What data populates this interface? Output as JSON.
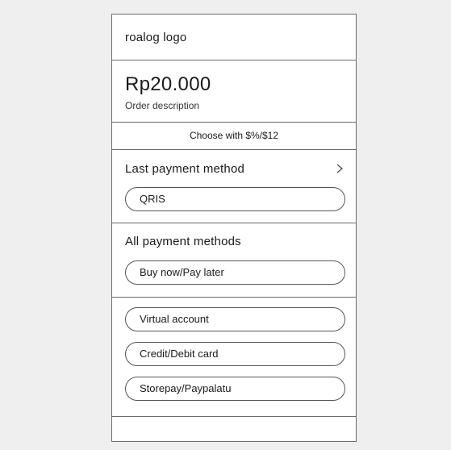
{
  "header": {
    "logo_text": "roalog logo"
  },
  "order": {
    "amount": "Rp20.000",
    "description": "Order description"
  },
  "choose": {
    "label": "Choose with $%/$12"
  },
  "last_payment": {
    "title": "Last payment method",
    "chevron_icon": "chevron-right-icon",
    "items": [
      {
        "label": "QRIS"
      }
    ]
  },
  "all_payment": {
    "title": "All payment methods",
    "items": [
      {
        "label": "Buy now/Pay later"
      }
    ]
  },
  "other_methods": {
    "items": [
      {
        "label": "Virtual account"
      },
      {
        "label": "Credit/Debit card"
      },
      {
        "label": "Storepay/Paypalatu"
      }
    ]
  },
  "colors": {
    "border": "#6b6b6b",
    "background": "#efefef",
    "surface": "#ffffff"
  }
}
